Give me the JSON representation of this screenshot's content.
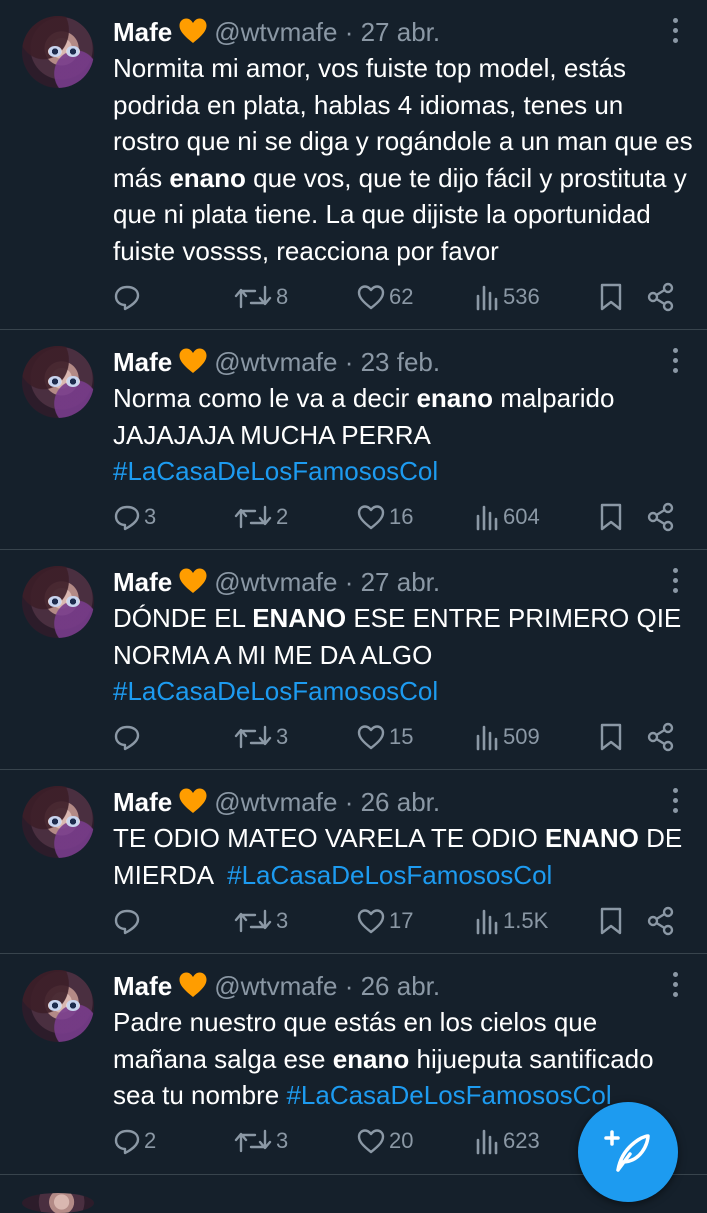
{
  "tweets": [
    {
      "name": "Mafe",
      "handle": "@wtvmafe",
      "dot": "·",
      "date": "27 abr.",
      "segments": [
        {
          "t": "Normita mi amor, vos fuiste top model, estás podrida en plata, hablas 4 idiomas, tenes un rostro que ni se diga y rogándole a un man que es más "
        },
        {
          "t": "enano",
          "bold": true
        },
        {
          "t": " que vos, que te dijo fácil y prostituta y que ni plata tiene. La que dijiste la oportunidad fuiste vossss, reacciona por favor"
        }
      ],
      "replies": "",
      "retweets": "8",
      "likes": "62",
      "views": "536"
    },
    {
      "name": "Mafe",
      "handle": "@wtvmafe",
      "dot": "·",
      "date": "23 feb.",
      "segments": [
        {
          "t": "Norma como le va a decir "
        },
        {
          "t": "enano",
          "bold": true
        },
        {
          "t": " malparido JAJAJAJA MUCHA PERRA "
        },
        {
          "t": "#LaCasaDeLosFamososCol",
          "tag": true
        }
      ],
      "replies": "3",
      "retweets": "2",
      "likes": "16",
      "views": "604"
    },
    {
      "name": "Mafe",
      "handle": "@wtvmafe",
      "dot": "·",
      "date": "27 abr.",
      "segments": [
        {
          "t": "DÓNDE EL "
        },
        {
          "t": "ENANO",
          "bold": true
        },
        {
          "t": " ESE ENTRE PRIMERO QIE NORMA A MI ME DA ALGO "
        },
        {
          "t": "#LaCasaDeLosFamososCol",
          "tag": true
        }
      ],
      "replies": "",
      "retweets": "3",
      "likes": "15",
      "views": "509"
    },
    {
      "name": "Mafe",
      "handle": "@wtvmafe",
      "dot": "·",
      "date": "26 abr.",
      "segments": [
        {
          "t": "TE ODIO MATEO VARELA TE ODIO "
        },
        {
          "t": "ENANO",
          "bold": true
        },
        {
          "t": " DE MIERDA  "
        },
        {
          "t": "#LaCasaDeLosFamososCol",
          "tag": true
        }
      ],
      "replies": "",
      "retweets": "3",
      "likes": "17",
      "views": "1.5K"
    },
    {
      "name": "Mafe",
      "handle": "@wtvmafe",
      "dot": "·",
      "date": "26 abr.",
      "segments": [
        {
          "t": "Padre nuestro que estás en los cielos que mañana salga ese "
        },
        {
          "t": "enano",
          "bold": true
        },
        {
          "t": " hijueputa santificado sea tu nombre "
        },
        {
          "t": "#LaCasaDeLosFamososCol",
          "tag": true
        }
      ],
      "replies": "2",
      "retweets": "3",
      "likes": "20",
      "views": "623"
    }
  ],
  "icons": {
    "heart_emoji": "orange-heart-icon",
    "reply": "reply-icon",
    "retweet": "retweet-icon",
    "like": "like-icon",
    "views": "views-icon",
    "bookmark": "bookmark-icon",
    "share": "share-icon",
    "more": "more-icon",
    "compose": "compose-tweet-icon"
  },
  "colors": {
    "background": "#15202b",
    "divider": "#38444d",
    "secondary_text": "#8b98a5",
    "hashtag": "#1d9bf0",
    "fab": "#1d9bf0",
    "heart_emoji": "#ff9d00"
  }
}
